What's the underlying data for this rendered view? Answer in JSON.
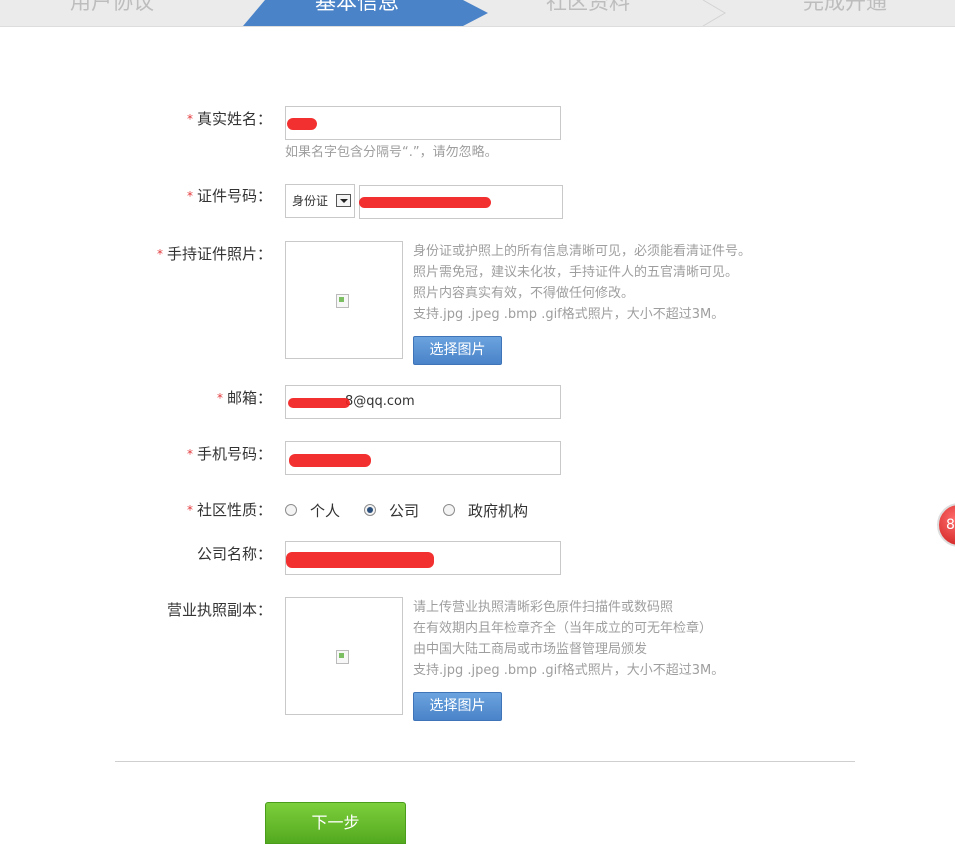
{
  "steps": [
    {
      "label": "用户协议",
      "active": false
    },
    {
      "label": "基本信息",
      "active": true
    },
    {
      "label": "社区资料",
      "active": false
    },
    {
      "label": "完成开通",
      "active": false
    }
  ],
  "form": {
    "real_name": {
      "label": "真实姓名：",
      "value": "",
      "hint": "如果名字包含分隔号“.”，请勿忽略。"
    },
    "id_number": {
      "label": "证件号码：",
      "type_selected": "身份证",
      "value": ""
    },
    "id_photo": {
      "label": "手持证件照片：",
      "hints": [
        "身份证或护照上的所有信息清晰可见，必须能看清证件号。",
        "照片需免冠，建议未化妆，手持证件人的五官清晰可见。",
        "照片内容真实有效，不得做任何修改。",
        "支持.jpg .jpeg .bmp .gif格式照片，大小不超过3M。"
      ],
      "button": "选择图片"
    },
    "email": {
      "label": "邮箱：",
      "value_suffix": "8@qq.com"
    },
    "phone": {
      "label": "手机号码：",
      "value": ""
    },
    "community_type": {
      "label": "社区性质：",
      "options": [
        "个人",
        "公司",
        "政府机构"
      ],
      "selected": "公司"
    },
    "company_name": {
      "label": "公司名称：",
      "value": ""
    },
    "license": {
      "label": "营业执照副本：",
      "hints": [
        "请上传营业执照清晰彩色原件扫描件或数码照",
        "在有效期内且年检章齐全（当年成立的可无年检章）",
        "由中国大陆工商局或市场监督管理局颁发",
        "支持.jpg .jpeg .bmp .gif格式照片，大小不超过3M。"
      ],
      "button": "选择图片"
    },
    "required_mark": "*"
  },
  "next_button": "下一步",
  "float_badge": "8",
  "colors": {
    "active_step": "#4a83c8",
    "required": "#e4393c",
    "next": "#53a91f",
    "redaction": "#f21e1e"
  }
}
